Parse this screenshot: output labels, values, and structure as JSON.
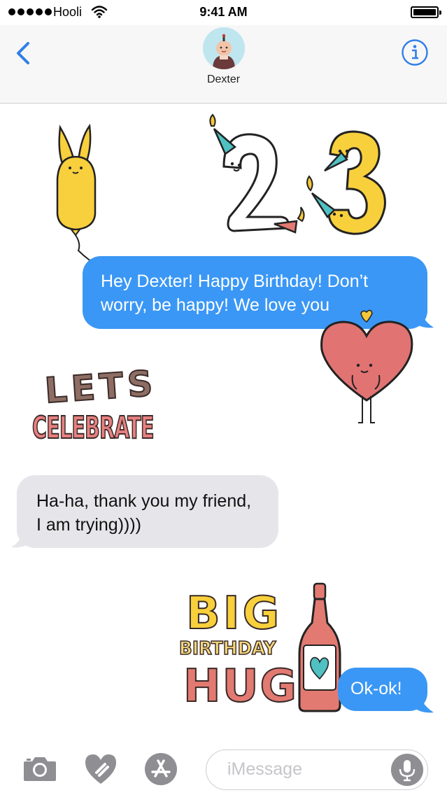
{
  "status_bar": {
    "carrier": "Hooli",
    "time": "9:41 AM",
    "battery_level": 1.0
  },
  "header": {
    "contact_name": "Dexter"
  },
  "messages": [
    {
      "direction": "outgoing",
      "text": "Hey Dexter! Happy Birthday! Don’t worry, be happy! We love you"
    },
    {
      "direction": "incoming",
      "text": "Ha-ha, thank you my friend, I am trying))))"
    },
    {
      "direction": "outgoing",
      "text": "Ok-ok!"
    }
  ],
  "stickers": {
    "lets": "LETS",
    "celebrate": "CELEBRATE",
    "big": "BIG",
    "birthday": "BIRTHDAY",
    "hug": "HUG",
    "number_age": "23"
  },
  "composer": {
    "placeholder": "iMessage"
  },
  "colors": {
    "accent": "#3a97f5",
    "incoming_bubble": "#e6e6ea",
    "icon_gray": "#8e8e93"
  },
  "icons": [
    "back-chevron",
    "info",
    "camera",
    "digital-touch-heart",
    "app-store",
    "microphone"
  ]
}
